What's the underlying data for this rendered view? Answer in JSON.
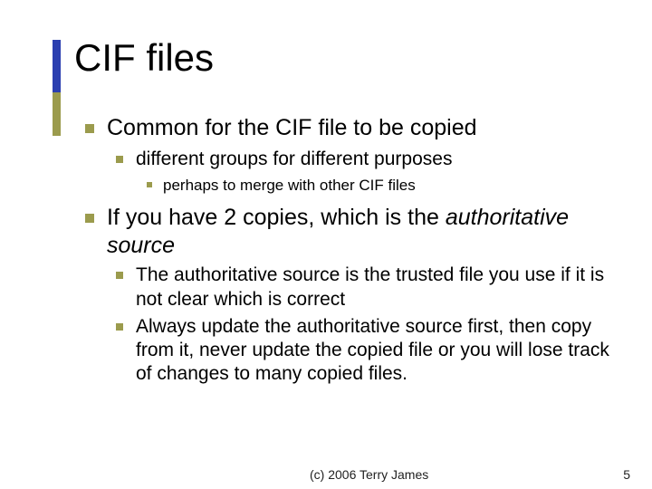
{
  "title": "CIF files",
  "bullets": {
    "b1": "Common for the CIF file to be copied",
    "b1_1": "different groups for different purposes",
    "b1_1_1": "perhaps to merge with other CIF files",
    "b2a": "If you have 2 copies, which is the ",
    "b2b": "authoritative source",
    "b2_1": "The authoritative source is the trusted file you use if it is not clear which is correct",
    "b2_2": "Always update the authoritative source first, then copy from it, never update the copied file or you will lose track of changes to many copied files."
  },
  "footer": {
    "copyright": "(c) 2006  Terry James",
    "page": "5"
  }
}
